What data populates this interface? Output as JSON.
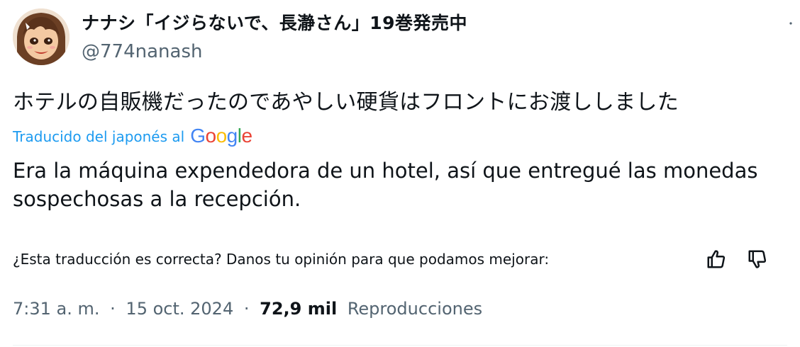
{
  "author": {
    "name": "ナナシ「イジらないで、長瀞さん」19巻発売中",
    "handle": "@774nanash"
  },
  "tweet": {
    "original_text": "ホテルの自販機だったのであやしい硬貨はフロントにお渡ししました",
    "translated_by_label": "Traducido del japonés al",
    "translated_by_brand": "Google",
    "translated_text": "Era la máquina expendedora de un hotel, así que entregué las monedas sospechosas a la recepción.",
    "feedback_prompt": "¿Esta traducción es correcta? Danos tu opinión para que podamos mejorar:"
  },
  "meta": {
    "time": "7:31 a. m.",
    "separator": "·",
    "date": "15 oct. 2024",
    "views_count": "72,9 mil",
    "views_label": "Reproducciones"
  },
  "icons": {
    "more": "more-icon",
    "thumbs_up": "thumbs-up-icon",
    "thumbs_down": "thumbs-down-icon"
  },
  "colors": {
    "link_blue": "#1d9bf0",
    "text_primary": "#0f1419",
    "text_secondary": "#536471",
    "google_blue": "#4285F4",
    "google_red": "#EA4335",
    "google_yellow": "#FBBC05",
    "google_green": "#34A853"
  }
}
